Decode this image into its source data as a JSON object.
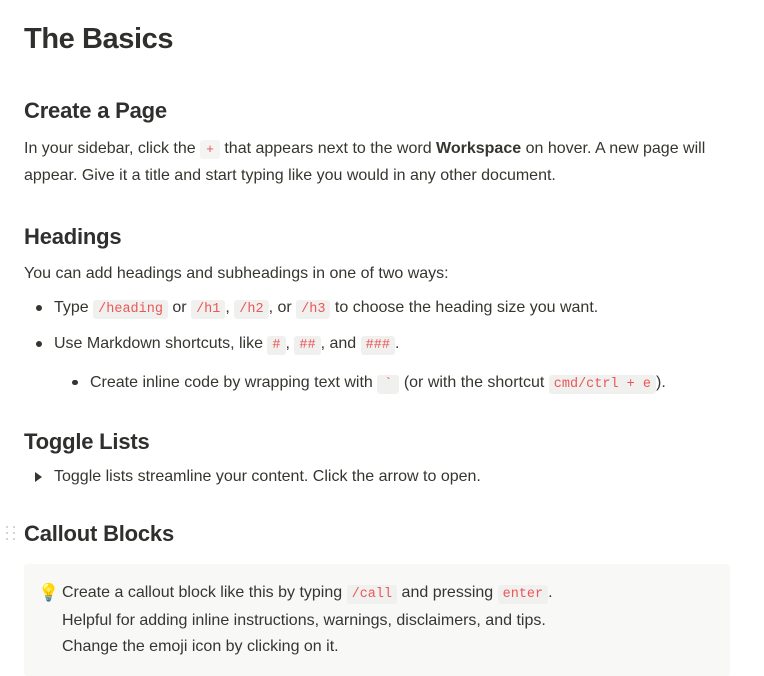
{
  "page": {
    "title": "The Basics"
  },
  "sections": {
    "create_page": {
      "heading": "Create a Page",
      "paragraph": {
        "part1": "In your sidebar, click the ",
        "code_plus": "+",
        "part2": " that appears next to the word ",
        "bold_workspace": "Workspace",
        "part3": " on hover. A new page will appear. Give it a title and start typing like you would in any other document."
      }
    },
    "headings": {
      "heading": "Headings",
      "intro": "You can add headings and subheadings in one of two ways:",
      "bullets": [
        {
          "part1": "Type ",
          "code1": "/heading",
          "part2": " or ",
          "code2": "/h1",
          "part3": ", ",
          "code3": "/h2",
          "part4": ", or ",
          "code4": "/h3",
          "part5": " to choose the heading size you want."
        },
        {
          "part1": "Use Markdown shortcuts, like ",
          "code1": "#",
          "part2": ", ",
          "code2": "##",
          "part3": ", and ",
          "code3": "###",
          "part4": "."
        }
      ],
      "nested_bullet": {
        "part1": "Create inline code by wrapping text with ",
        "code1": "`",
        "part2": " (or with the shortcut ",
        "code2": "cmd/ctrl + e",
        "part3": ")."
      }
    },
    "toggle_lists": {
      "heading": "Toggle Lists",
      "toggle_text": "Toggle lists streamline your content. Click the arrow to open."
    },
    "callout_blocks": {
      "heading": "Callout Blocks",
      "callout": {
        "emoji": "💡",
        "line1": {
          "part1": "Create a callout block like this by typing ",
          "code1": "/call",
          "part2": " and pressing ",
          "code2": "enter",
          "part3": "."
        },
        "line2": "Helpful for adding inline instructions, warnings, disclaimers, and tips.",
        "line3": "Change the emoji icon by clicking on it."
      }
    }
  },
  "colors": {
    "text": "#37352f",
    "code_text": "#eb5757",
    "code_bg": "#f0f0ef",
    "callout_bg": "#f8f8f7",
    "handle_dot": "#c7c7c4"
  }
}
